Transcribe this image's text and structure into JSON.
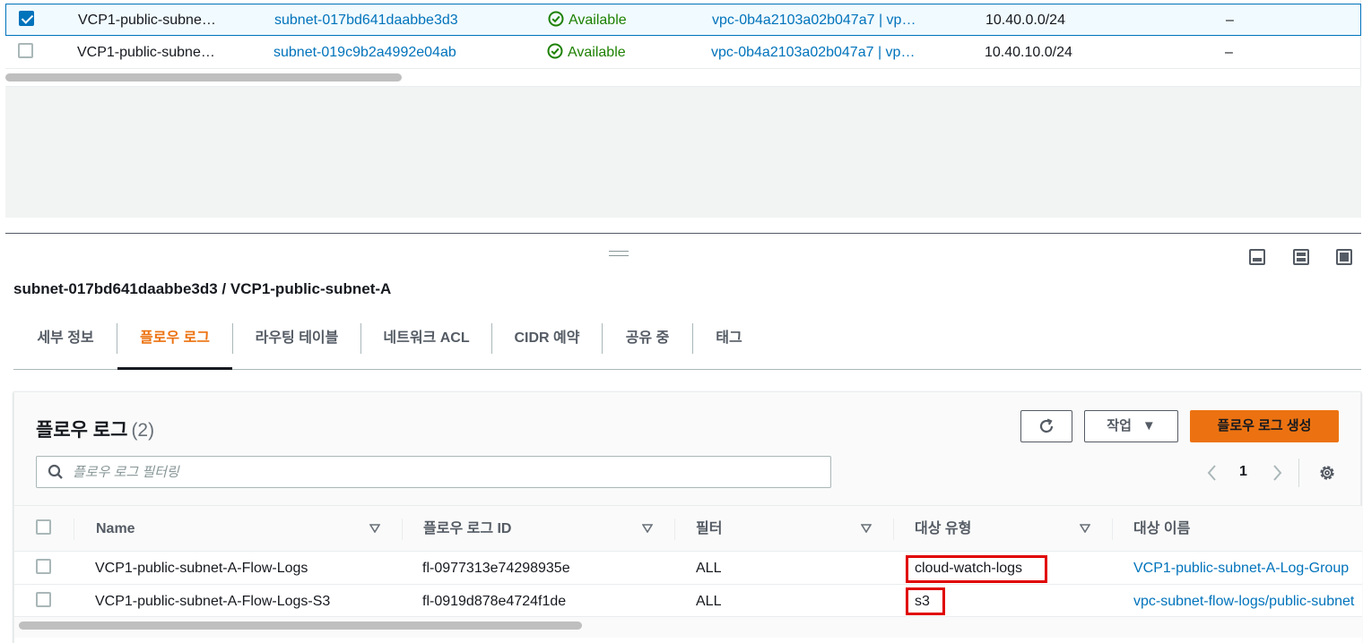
{
  "subnets": {
    "rows": [
      {
        "selected": true,
        "name": "VCP1-public-subne…",
        "id": "subnet-017bd641daabbe3d3",
        "state": "Available",
        "vpc": "vpc-0b4a2103a02b047a7 | vp…",
        "cidr": "10.40.0.0/24",
        "extra": "–"
      },
      {
        "selected": false,
        "name": "VCP1-public-subne…",
        "id": "subnet-019c9b2a4992e04ab",
        "state": "Available",
        "vpc": "vpc-0b4a2103a02b047a7 | vp…",
        "cidr": "10.40.10.0/24",
        "extra": "–"
      }
    ]
  },
  "details": {
    "title": "subnet-017bd641daabbe3d3 / VCP1-public-subnet-A",
    "tabs": [
      {
        "label": "세부 정보",
        "active": false
      },
      {
        "label": "플로우 로그",
        "active": true
      },
      {
        "label": "라우팅 테이블",
        "active": false
      },
      {
        "label": "네트워크 ACL",
        "active": false
      },
      {
        "label": "CIDR 예약",
        "active": false
      },
      {
        "label": "공유 중",
        "active": false
      },
      {
        "label": "태그",
        "active": false
      }
    ]
  },
  "flow_logs": {
    "heading": "플로우 로그",
    "count": "(2)",
    "action_label": "작업",
    "create_label": "플로우 로그 생성",
    "search_placeholder": "플로우 로그 필터링",
    "page": "1",
    "columns": [
      "Name",
      "플로우 로그 ID",
      "필터",
      "대상 유형",
      "대상 이름"
    ],
    "rows": [
      {
        "name": "VCP1-public-subnet-A-Flow-Logs",
        "id": "fl-0977313e74298935e",
        "filter": "ALL",
        "dest_type": "cloud-watch-logs",
        "dest_name": "VCP1-public-subnet-A-Log-Group"
      },
      {
        "name": "VCP1-public-subnet-A-Flow-Logs-S3",
        "id": "fl-0919d878e4724f1de",
        "filter": "ALL",
        "dest_type": "s3",
        "dest_name": "vpc-subnet-flow-logs/public-subnet"
      }
    ]
  },
  "colors": {
    "link": "#0073bb",
    "success": "#1d8102",
    "accent": "#ec7211",
    "highlight": "#e00000"
  },
  "icons": {
    "status": "check-circle-icon",
    "refresh": "refresh-icon",
    "search": "search-icon",
    "settings": "gear-icon"
  }
}
